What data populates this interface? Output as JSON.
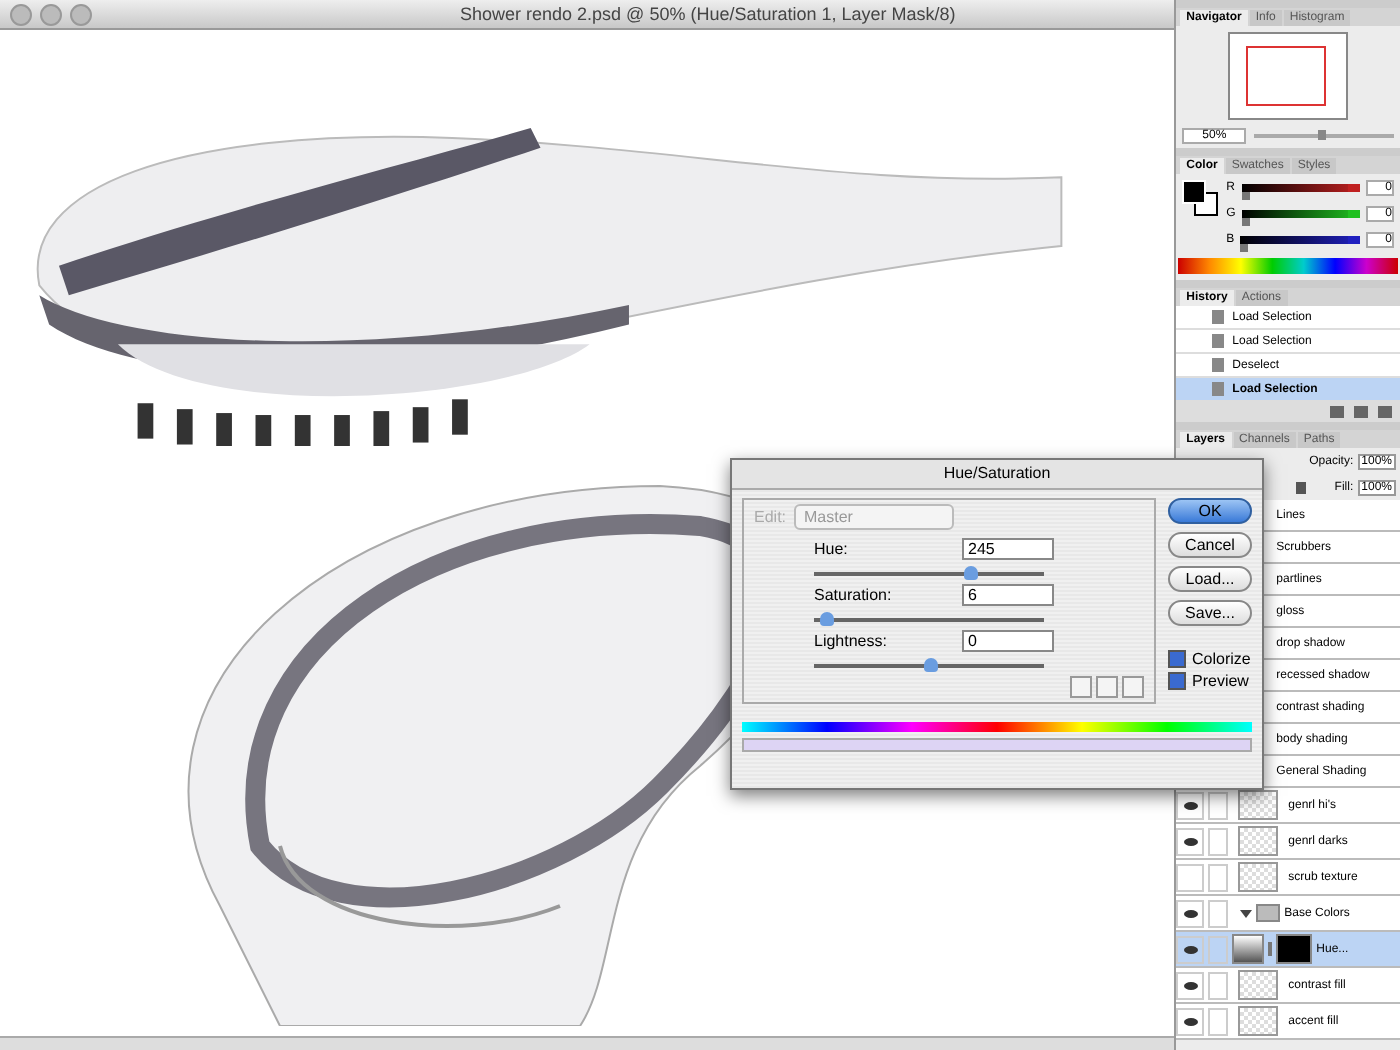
{
  "window": {
    "title": "Shower rendo 2.psd @ 50% (Hue/Saturation 1, Layer Mask/8)"
  },
  "navigator": {
    "tabs": [
      {
        "label": "Navigator",
        "selected": true
      },
      {
        "label": "Info",
        "selected": false
      },
      {
        "label": "Histogram",
        "selected": false
      }
    ],
    "zoom": "50%",
    "level": 0.45
  },
  "color": {
    "tabs": [
      {
        "label": "Color",
        "selected": true
      },
      {
        "label": "Swatches",
        "selected": false
      },
      {
        "label": "Styles",
        "selected": false
      }
    ],
    "channels": [
      {
        "name": "R",
        "value": "0",
        "level": 0,
        "color": "#c02020"
      },
      {
        "name": "G",
        "value": "0",
        "level": 0,
        "color": "#20c020"
      },
      {
        "name": "B",
        "value": "0",
        "level": 0,
        "color": "#2020c0"
      }
    ]
  },
  "history": {
    "tabs": [
      {
        "label": "History",
        "selected": true
      },
      {
        "label": "Actions",
        "selected": false
      }
    ],
    "items": [
      {
        "label": "Load Selection",
        "selected": false
      },
      {
        "label": "Load Selection",
        "selected": false
      },
      {
        "label": "Deselect",
        "selected": false
      },
      {
        "label": "Load Selection",
        "selected": true
      }
    ]
  },
  "layers": {
    "tabs": [
      {
        "label": "Layers",
        "selected": true
      },
      {
        "label": "Channels",
        "selected": false
      },
      {
        "label": "Paths",
        "selected": false
      }
    ],
    "opacity_label": "Opacity:",
    "opacity": "100%",
    "fill_label": "Fill:",
    "fill": "100%",
    "items": [
      {
        "kind": "plain",
        "name": "Lines"
      },
      {
        "kind": "plain",
        "name": "Scrubbers"
      },
      {
        "kind": "plain",
        "name": "partlines"
      },
      {
        "kind": "plain",
        "name": "gloss"
      },
      {
        "kind": "plain",
        "name": "drop shadow"
      },
      {
        "kind": "plain",
        "name": "recessed shadow"
      },
      {
        "kind": "plain",
        "name": "contrast shading"
      },
      {
        "kind": "plain",
        "name": "body shading"
      },
      {
        "kind": "plain",
        "name": "General Shading"
      },
      {
        "kind": "layer",
        "name": "genrl hi's",
        "visible": true,
        "selected": false
      },
      {
        "kind": "layer",
        "name": "genrl darks",
        "visible": true,
        "selected": false
      },
      {
        "kind": "layer",
        "name": "scrub texture",
        "visible": false,
        "selected": false
      },
      {
        "kind": "group",
        "name": "Base Colors",
        "visible": true,
        "expanded": true
      },
      {
        "kind": "adjustment",
        "name": "Hue...",
        "visible": true,
        "selected": true
      },
      {
        "kind": "layer",
        "name": "contrast fill",
        "visible": true,
        "selected": false
      },
      {
        "kind": "layer",
        "name": "accent fill",
        "visible": true,
        "selected": false
      }
    ]
  },
  "dialog": {
    "title": "Hue/Saturation",
    "edit_label": "Edit:",
    "edit_value": "Master",
    "sliders": [
      {
        "label": "Hue:",
        "value": "245",
        "level": 0.68
      },
      {
        "label": "Saturation:",
        "value": "6",
        "level": 0.05
      },
      {
        "label": "Lightness:",
        "value": "0",
        "level": 0.5
      }
    ],
    "buttons": [
      {
        "label": "OK",
        "default": true
      },
      {
        "label": "Cancel",
        "default": false
      },
      {
        "label": "Load...",
        "default": false
      },
      {
        "label": "Save...",
        "default": false
      }
    ],
    "checks": [
      {
        "label": "Colorize",
        "checked": true
      },
      {
        "label": "Preview",
        "checked": true
      }
    ]
  }
}
